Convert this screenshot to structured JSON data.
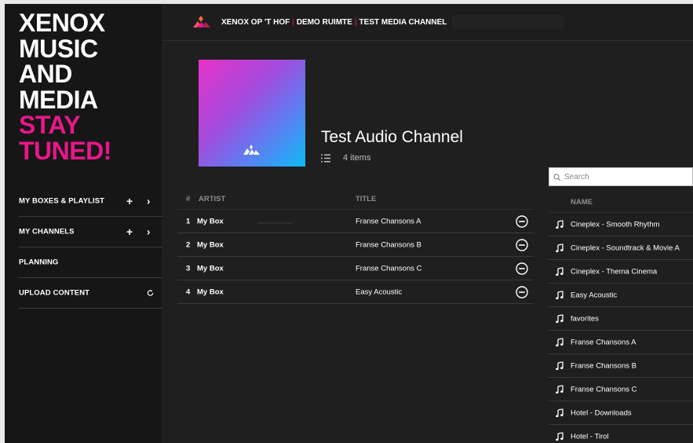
{
  "brand": {
    "lines_white": [
      "XENOX",
      "MUSIC",
      "AND",
      "MEDIA"
    ],
    "lines_pink": [
      "STAY",
      "TUNED!"
    ],
    "accent_color": "#e8178a"
  },
  "sidebar": {
    "items": [
      {
        "label": "MY BOXES & PLAYLIST",
        "actions": [
          "plus-icon",
          "chevron-right-icon"
        ]
      },
      {
        "label": "MY CHANNELS",
        "actions": [
          "plus-icon",
          "chevron-right-icon"
        ]
      },
      {
        "label": "PLANNING",
        "actions": []
      },
      {
        "label": "UPLOAD CONTENT",
        "actions": [
          "sync-icon"
        ]
      }
    ]
  },
  "header": {
    "breadcrumb": [
      "XENOX OP 'T HOF",
      "DEMO RUIMTE",
      "TEST MEDIA CHANNEL"
    ],
    "separator": "|"
  },
  "channel": {
    "title": "Test Audio Channel",
    "count": "4 items"
  },
  "tracks": {
    "headers": {
      "num": "#",
      "artist": "ARTIST",
      "title": "TITLE"
    },
    "rows": [
      {
        "num": "1",
        "artist": "My Box",
        "title": "Franse Chansons A"
      },
      {
        "num": "2",
        "artist": "My Box",
        "title": "Franse Chansons B"
      },
      {
        "num": "3",
        "artist": "My Box",
        "title": "Franse Chansons C"
      },
      {
        "num": "4",
        "artist": "My Box",
        "title": "Easy Acoustic"
      }
    ]
  },
  "library": {
    "search_placeholder": "Search",
    "header": "NAME",
    "items": [
      "Cineplex - Smooth Rhythm",
      "Cineplex - Soundtrack & Movie A",
      "Cineplex - Thema Cinema",
      "Easy Acoustic",
      "favorites",
      "Franse Chansons A",
      "Franse Chansons B",
      "Franse Chansons C",
      "Hotel - Downloads",
      "Hotel - Tirol"
    ]
  }
}
